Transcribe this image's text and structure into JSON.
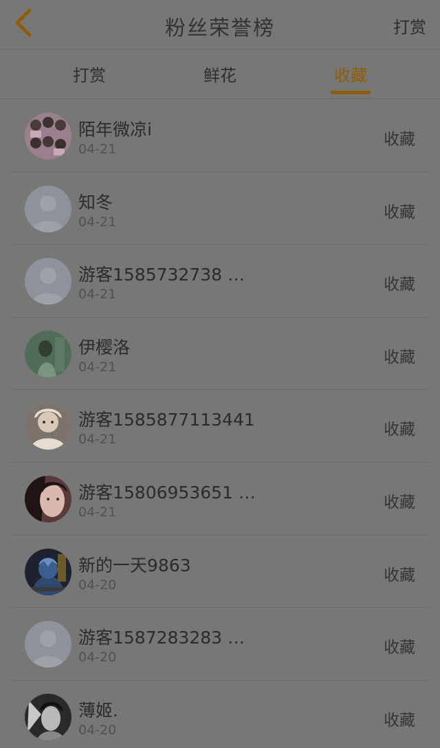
{
  "header": {
    "title": "粉丝荣誉榜",
    "right_label": "打赏"
  },
  "tabs": [
    {
      "label": "打赏",
      "active": false
    },
    {
      "label": "鲜花",
      "active": false
    },
    {
      "label": "收藏",
      "active": true
    }
  ],
  "colors": {
    "accent": "#8f5c0c",
    "background": "#777776"
  },
  "list": [
    {
      "name": "陌年微凉i",
      "date": "04-21",
      "action": "收藏",
      "avatar": "photo-group"
    },
    {
      "name": "知冬",
      "date": "04-21",
      "action": "收藏",
      "avatar": "default-avatar"
    },
    {
      "name": "游客1585732738 …",
      "date": "04-21",
      "action": "收藏",
      "avatar": "default-avatar"
    },
    {
      "name": "伊樱洛",
      "date": "04-21",
      "action": "收藏",
      "avatar": "photo-green"
    },
    {
      "name": "游客1585877113441",
      "date": "04-21",
      "action": "收藏",
      "avatar": "photo-child"
    },
    {
      "name": "游客15806953651 …",
      "date": "04-21",
      "action": "收藏",
      "avatar": "photo-portrait"
    },
    {
      "name": "新的一天9863",
      "date": "04-20",
      "action": "收藏",
      "avatar": "photo-anime"
    },
    {
      "name": "游客1587283283 …",
      "date": "04-20",
      "action": "收藏",
      "avatar": "default-avatar"
    },
    {
      "name": "薄姬.",
      "date": "04-20",
      "action": "收藏",
      "avatar": "photo-dark"
    }
  ]
}
